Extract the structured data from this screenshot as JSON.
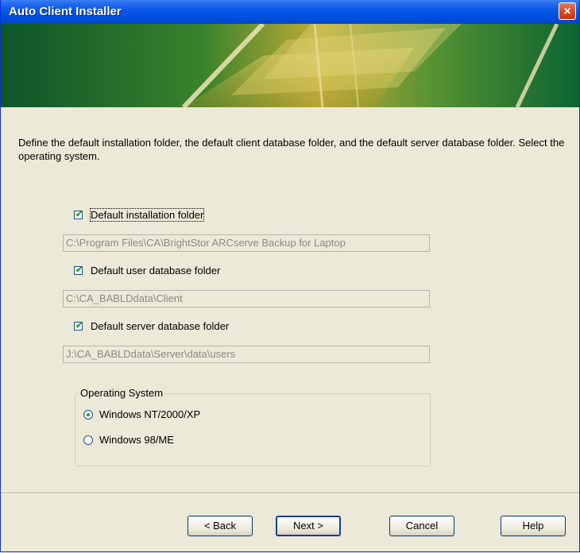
{
  "window": {
    "title": "Auto Client Installer",
    "close_glyph": "×"
  },
  "description": "Define the default installation folder, the default client database folder, and the default server database folder.  Select the operating system.",
  "options": [
    {
      "label": "Default installation folder",
      "checked": true,
      "path": "C:\\Program Files\\CA\\BrightStor ARCserve Backup for Laptop"
    },
    {
      "label": "Default user database folder",
      "checked": true,
      "path": "C:\\CA_BABLDdata\\Client"
    },
    {
      "label": "Default server database folder",
      "checked": true,
      "path": "J:\\CA_BABLDdata\\Server\\data\\users"
    }
  ],
  "os_group": {
    "label": "Operating System",
    "choices": [
      {
        "label": "Windows NT/2000/XP",
        "selected": true
      },
      {
        "label": "Windows 98/ME",
        "selected": false
      }
    ]
  },
  "buttons": {
    "back": "< Back",
    "next": "Next >",
    "cancel": "Cancel",
    "help": "Help"
  },
  "icons": {
    "check": "check-icon",
    "close": "close-icon"
  },
  "colors": {
    "titlebar": "#0a5ae8",
    "dialog_bg": "#ece9d8",
    "check_green": "#21a121"
  }
}
